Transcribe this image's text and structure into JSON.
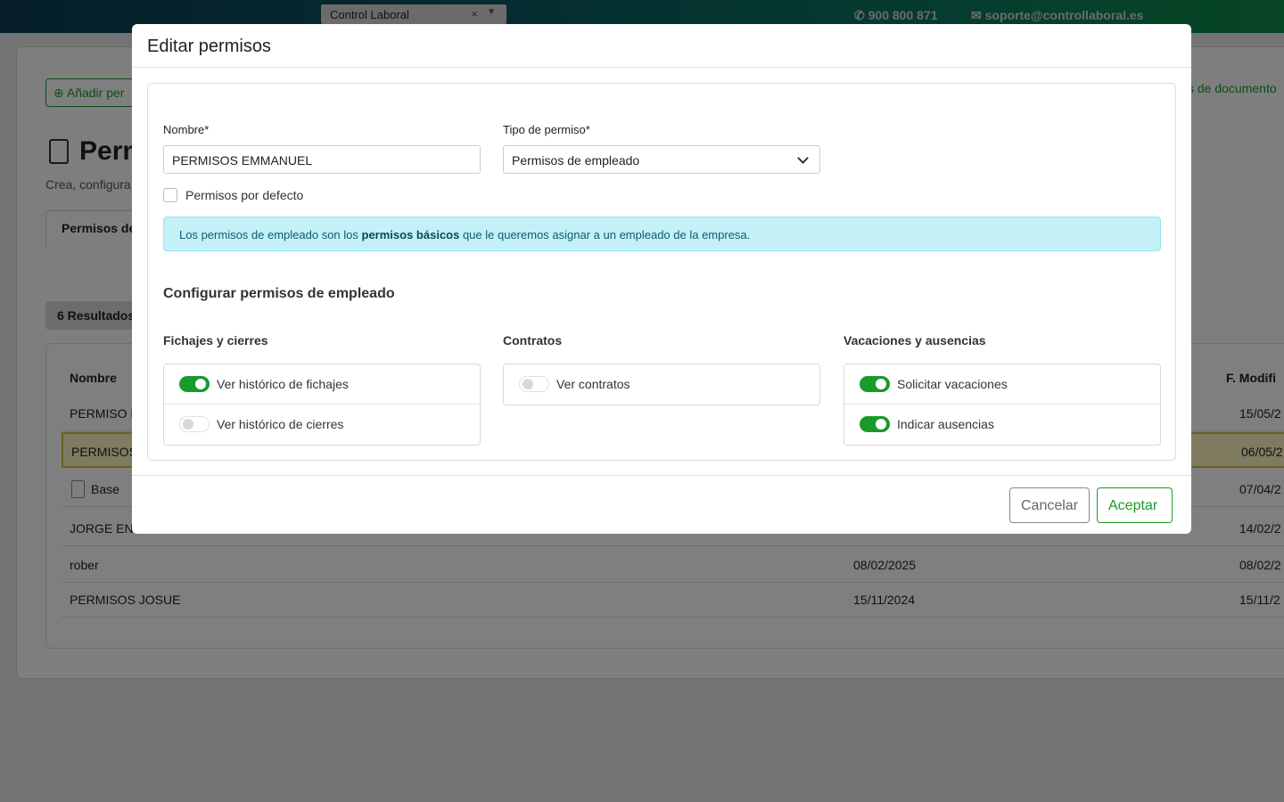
{
  "topbar": {
    "tab_label": "Control Laboral",
    "tab_close": "×",
    "phone": "900 800 871",
    "email": "soporte@controllaboral.es"
  },
  "background": {
    "add_button": "Añadir per",
    "docs_link": "s de documento",
    "title": "Perm",
    "subtitle": "Crea, configura",
    "tab": "Permisos de",
    "results": "6 Resultados",
    "columns": {
      "name": "Nombre",
      "modified": "F. Modifi"
    },
    "rows": [
      {
        "name": "PERMISO F",
        "created": "",
        "modified": "15/05/2"
      },
      {
        "name": "PERMISOS",
        "created": "",
        "modified": "06/05/2"
      },
      {
        "name": "Base",
        "created": "",
        "modified": "07/04/2"
      },
      {
        "name": "JORGE ENC",
        "created": "",
        "modified": "14/02/2"
      },
      {
        "name": "rober",
        "created": "08/02/2025",
        "modified": "08/02/2"
      },
      {
        "name": "PERMISOS JOSUE",
        "created": "15/11/2024",
        "modified": "15/11/2"
      }
    ]
  },
  "modal": {
    "title": "Editar permisos",
    "name_label": "Nombre*",
    "name_value": "PERMISOS EMMANUEL",
    "type_label": "Tipo de permiso*",
    "type_value": "Permisos de empleado",
    "default_label": "Permisos por defecto",
    "default_checked": false,
    "info_pre": "Los permisos de empleado son los ",
    "info_bold": "permisos básicos",
    "info_post": " que le queremos asignar a un empleado de la empresa.",
    "section_title": "Configurar permisos de empleado",
    "groups": [
      {
        "title": "Fichajes y cierres",
        "items": [
          {
            "label": "Ver histórico de fichajes",
            "on": true
          },
          {
            "label": "Ver histórico de cierres",
            "on": false
          }
        ]
      },
      {
        "title": "Contratos",
        "items": [
          {
            "label": "Ver contratos",
            "on": false
          }
        ]
      },
      {
        "title": "Vacaciones y ausencias",
        "items": [
          {
            "label": "Solicitar vacaciones",
            "on": true
          },
          {
            "label": "Indicar ausencias",
            "on": true
          }
        ]
      }
    ],
    "cancel_label": "Cancelar",
    "ok_label": "Aceptar"
  },
  "colors": {
    "accent": "#1a9a2a",
    "info_bg": "#c3f1f7",
    "selected_row": "#fff6c2"
  }
}
